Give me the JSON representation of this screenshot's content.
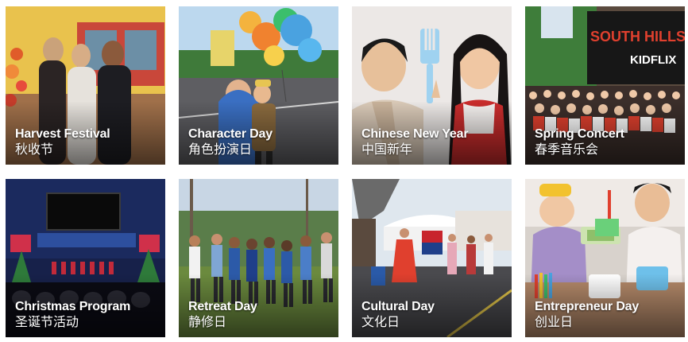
{
  "gallery": {
    "tiles": [
      {
        "title": "Harvest Festival",
        "subtitle": "秋收节"
      },
      {
        "title": "Character Day",
        "subtitle": "角色扮演日"
      },
      {
        "title": "Chinese New Year",
        "subtitle": "中国新年"
      },
      {
        "title": "Spring Concert",
        "subtitle": "春季音乐会",
        "banner_line1": "SOUTH HILLS AC",
        "banner_line2": "KIDFLIX"
      },
      {
        "title": "Christmas Program",
        "subtitle": "圣诞节活动"
      },
      {
        "title": "Retreat Day",
        "subtitle": "静修日"
      },
      {
        "title": "Cultural Day",
        "subtitle": "文化日"
      },
      {
        "title": "Entrepreneur Day",
        "subtitle": "创业日"
      }
    ]
  }
}
